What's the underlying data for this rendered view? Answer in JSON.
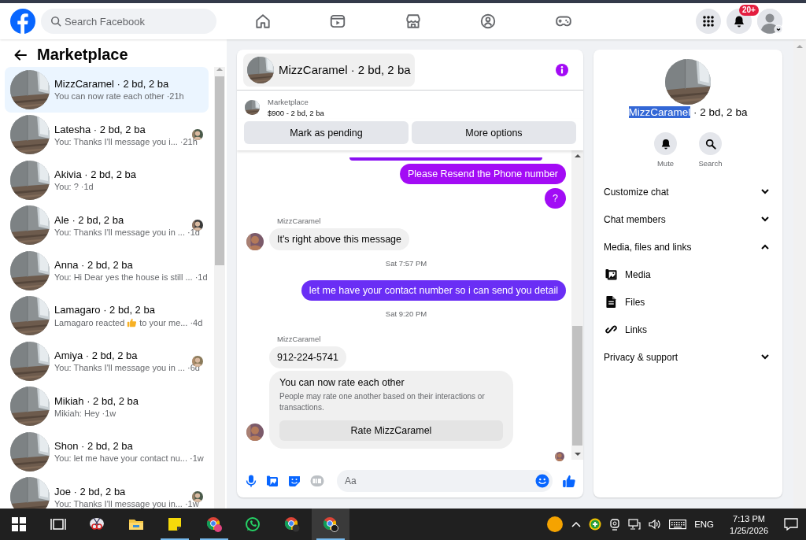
{
  "top_bar": {
    "search": {
      "placeholder": "Search Facebook"
    },
    "notifications_badge": "20+"
  },
  "sidebar": {
    "title": "Marketplace",
    "conversations": [
      {
        "name": "MizzCaramel · 2 bd, 2 ba",
        "preview": "You can now rate each other",
        "time": "·21h",
        "selected": true,
        "seen": false
      },
      {
        "name": "Latesha · 2 bd, 2 ba",
        "preview": "You: Thanks I'll message you i...",
        "time": "·21h",
        "selected": false,
        "seen": true
      },
      {
        "name": "Akivia · 2 bd, 2 ba",
        "preview": "You: ?",
        "time": "·1d",
        "selected": false,
        "seen": false
      },
      {
        "name": "Ale · 2 bd, 2 ba",
        "preview": "You: Thanks I'll message you in ...",
        "time": "·1d",
        "selected": false,
        "seen": true
      },
      {
        "name": "Anna · 2 bd, 2 ba",
        "preview": "You: Hi Dear yes the house is still ...",
        "time": "·1d",
        "selected": false,
        "seen": false
      },
      {
        "name": "Lamagaro · 2 bd, 2 ba",
        "preview": "Lamagaro reacted",
        "preview_after": "to your me...",
        "time": "·4d",
        "selected": false,
        "seen": false
      },
      {
        "name": "Amiya · 2 bd, 2 ba",
        "preview": "You: Thanks I'll message you in ...",
        "time": "·6d",
        "selected": false,
        "seen": true
      },
      {
        "name": "Mikiah · 2 bd, 2 ba",
        "preview": "Mikiah: Hey",
        "time": "·1w",
        "selected": false,
        "seen": false
      },
      {
        "name": "Shon · 2 bd, 2 ba",
        "preview": "You: let me have your contact nu...",
        "time": "·1w",
        "selected": false,
        "seen": false
      },
      {
        "name": "Joe · 2 bd, 2 ba",
        "preview": "You: Thanks I'll message you in...",
        "time": "·1w",
        "selected": false,
        "seen": true
      }
    ]
  },
  "chat": {
    "title": "MizzCaramel · 2 bd, 2 ba",
    "listing": {
      "label": "Marketplace",
      "price": "$900 - 2 bd, 2 ba"
    },
    "actions": [
      "Mark as pending",
      "More options"
    ],
    "messages": [
      {
        "kind": "outgoing",
        "text": "Please Resend the Phone number",
        "color": "#a30bf5"
      },
      {
        "kind": "outgoing",
        "text": "?",
        "color": "#a10cf5"
      },
      {
        "kind": "incoming",
        "sender": "MizzCaramel",
        "text": "It's right above this message",
        "avatar": true
      },
      {
        "kind": "timestamp",
        "text": "Sat 7:57 PM"
      },
      {
        "kind": "outgoing",
        "text": "let me have your contact number so i can send you detail",
        "color": "#6a2ef5"
      },
      {
        "kind": "timestamp",
        "text": "Sat 9:20 PM"
      },
      {
        "kind": "incoming",
        "sender": "MizzCaramel",
        "text": "912-224-5741",
        "avatar": false
      },
      {
        "kind": "rating",
        "title": "You can now rate each other",
        "body": "People may rate one another based on their interactions or transactions.",
        "button": "Rate MizzCaramel",
        "avatar": true
      }
    ],
    "composer": {
      "placeholder": "Aa"
    }
  },
  "details": {
    "title_selected": "MizzCaramel",
    "title_rest": " · 2 bd, 2 ba",
    "actions": [
      {
        "label": "Mute"
      },
      {
        "label": "Search"
      }
    ],
    "sections": [
      {
        "label": "Customize chat",
        "expanded": false
      },
      {
        "label": "Chat members",
        "expanded": false
      },
      {
        "label": "Media, files and links",
        "expanded": true,
        "children": [
          {
            "label": "Media"
          },
          {
            "label": "Files"
          },
          {
            "label": "Links"
          }
        ]
      },
      {
        "label": "Privacy & support",
        "expanded": false
      }
    ]
  },
  "taskbar": {
    "apps": [
      {
        "running": false,
        "selected": false
      },
      {
        "running": false,
        "selected": false
      },
      {
        "running": false,
        "selected": false
      },
      {
        "running": false,
        "selected": false
      },
      {
        "running": true,
        "selected": false
      },
      {
        "running": true,
        "selected": false
      },
      {
        "running": false,
        "selected": false
      },
      {
        "running": false,
        "selected": false
      },
      {
        "running": true,
        "selected": true
      }
    ],
    "language": "ENG",
    "time": "7:13 PM",
    "date": "1/25/2026"
  }
}
